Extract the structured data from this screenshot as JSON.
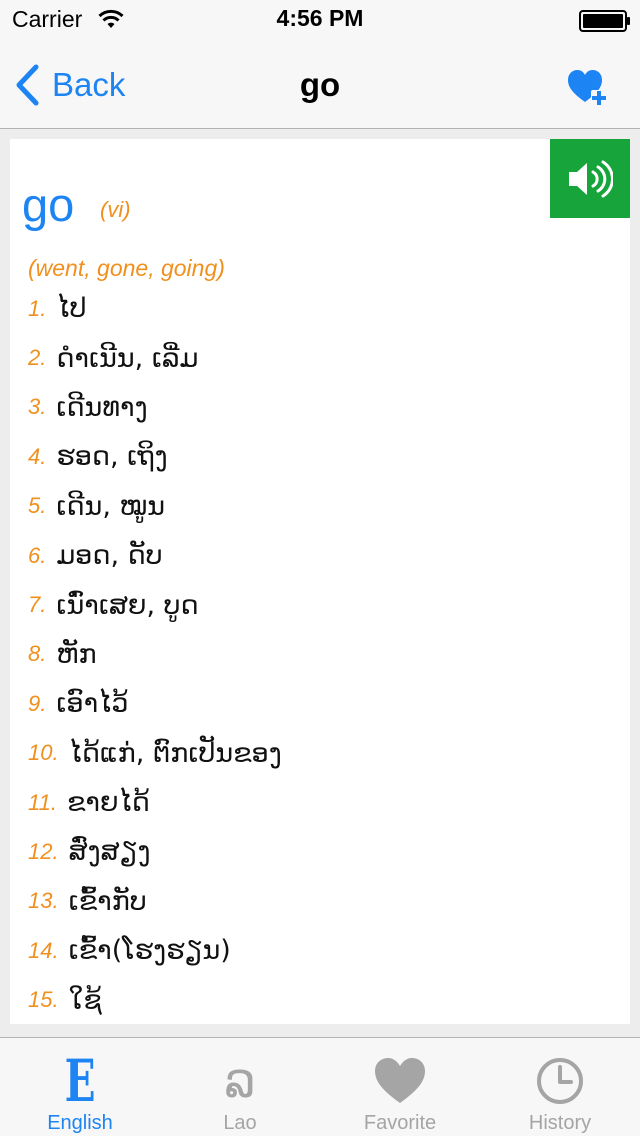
{
  "status_bar": {
    "carrier": "Carrier",
    "time": "4:56 PM"
  },
  "nav": {
    "back_label": "Back",
    "title": "go"
  },
  "entry": {
    "headword": "go",
    "part_of_speech": "(vi)",
    "forms": "(went, gone, going)",
    "meanings": [
      {
        "num": "1.",
        "text": "ໄປ"
      },
      {
        "num": "2.",
        "text": "ດຳເນີນ, ເລີ່ມ"
      },
      {
        "num": "3.",
        "text": "ເດີນທາງ"
      },
      {
        "num": "4.",
        "text": "ຮອດ, ເຖິງ"
      },
      {
        "num": "5.",
        "text": "ເດີນ, ໝູນ"
      },
      {
        "num": "6.",
        "text": "ມອດ, ດັບ"
      },
      {
        "num": "7.",
        "text": "ເນົ່າເສຍ, ບູດ"
      },
      {
        "num": "8.",
        "text": "ຫັກ"
      },
      {
        "num": "9.",
        "text": "ເອົາໄວ້"
      },
      {
        "num": "10.",
        "text": "ໄດ້ແກ່, ຕົກເປັນຂອງ"
      },
      {
        "num": "11.",
        "text": "ຂາຍໄດ້"
      },
      {
        "num": "12.",
        "text": "ສົ່ງສຽງ"
      },
      {
        "num": "13.",
        "text": "ເຂົ້າກັບ"
      },
      {
        "num": "14.",
        "text": "ເຂົ້າ(ໂຮງຮຽນ)"
      },
      {
        "num": "15.",
        "text": "ໃຊ້"
      }
    ]
  },
  "tabs": [
    {
      "label": "English",
      "icon": "english-letter-icon",
      "active": true
    },
    {
      "label": "Lao",
      "icon": "lao-letter-icon",
      "active": false
    },
    {
      "label": "Favorite",
      "icon": "heart-icon",
      "active": false
    },
    {
      "label": "History",
      "icon": "clock-icon",
      "active": false
    }
  ],
  "colors": {
    "accent_blue": "#1d84f3",
    "orange": "#f0901e",
    "speaker_green": "#17a53b",
    "inactive_gray": "#a5a5a5"
  }
}
